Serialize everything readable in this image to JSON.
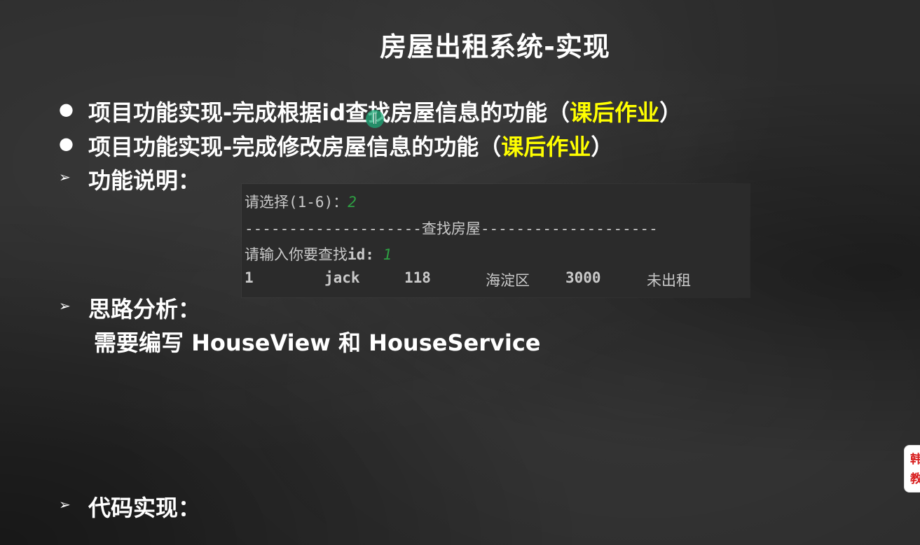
{
  "slide": {
    "title": "房屋出租系统-实现"
  },
  "bullets": [
    {
      "marker": "●",
      "text": "项目功能实现-完成根据id查找房屋信息的功能（",
      "highlight": "课后作业",
      "suffix": "）"
    },
    {
      "marker": "●",
      "text": "项目功能实现-完成修改房屋信息的功能（",
      "highlight": "课后作业",
      "suffix": "）"
    }
  ],
  "sections": {
    "function_desc": {
      "marker": "➢",
      "text": "功能说明："
    },
    "analysis": {
      "marker": "➢",
      "text": "思路分析："
    },
    "analysis_note": "需要编写 HouseView 和 HouseService",
    "code": {
      "marker": "➢",
      "text": "代码实现："
    }
  },
  "console": {
    "line1_prompt": "请选择(1-6)：",
    "line1_input": "2",
    "line2": "--------------------查找房屋--------------------",
    "line3_prompt_cn": "请输入你要查找",
    "line3_prompt_id": "id: ",
    "line3_input": "1",
    "result_row": [
      "1",
      "jack",
      "118",
      "海淀区",
      "3000",
      "未出租"
    ]
  },
  "side_badge": {
    "line1": "韩",
    "line2": "教"
  },
  "colors": {
    "highlight": "#ffff00",
    "console_input": "#2ea043",
    "background": "#2b2b2b"
  }
}
